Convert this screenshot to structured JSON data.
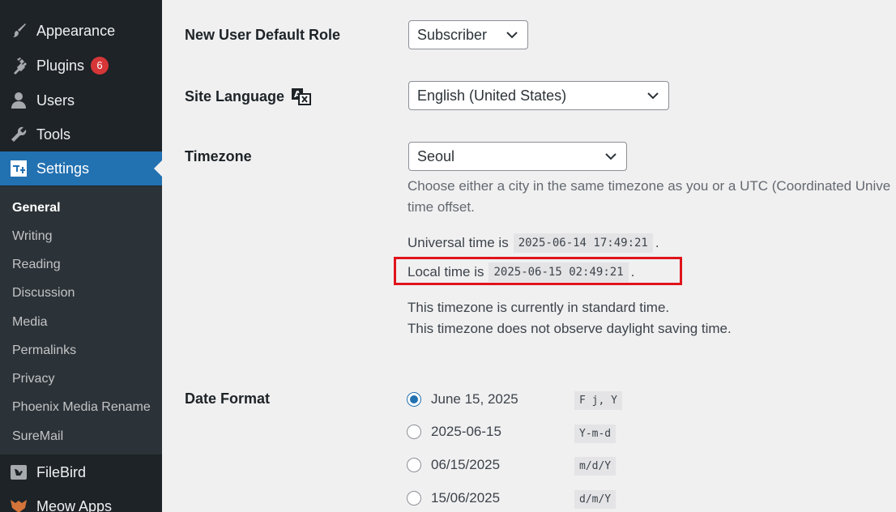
{
  "sidebar": {
    "menu": [
      {
        "label": "Appearance",
        "icon": "paintbrush-icon"
      },
      {
        "label": "Plugins",
        "icon": "plugin-icon",
        "badge": "6"
      },
      {
        "label": "Users",
        "icon": "user-icon"
      },
      {
        "label": "Tools",
        "icon": "wrench-icon"
      },
      {
        "label": "Settings",
        "icon": "settings-icon",
        "active": true
      }
    ],
    "submenu": [
      "General",
      "Writing",
      "Reading",
      "Discussion",
      "Media",
      "Permalinks",
      "Privacy",
      "Phoenix Media Rename",
      "SureMail"
    ],
    "current_submenu": "General",
    "after": [
      {
        "label": "FileBird",
        "icon": "filebird-icon"
      },
      {
        "label": "Meow Apps",
        "icon": "meow-apps-icon"
      }
    ]
  },
  "settings": {
    "default_role": {
      "label": "New User Default Role",
      "value": "Subscriber"
    },
    "site_language": {
      "label": "Site Language",
      "value": "English (United States)"
    },
    "timezone": {
      "label": "Timezone",
      "value": "Seoul",
      "description_line1": "Choose either a city in the same timezone as you or a UTC (Coordinated Unive",
      "description_line2": "time offset.",
      "universal_prefix": "Universal time is",
      "universal_value": "2025-06-14 17:49:21",
      "local_prefix": "Local time is",
      "local_value": "2025-06-15 02:49:21",
      "period": ".",
      "standard_note": "This timezone is currently in standard time.",
      "dst_note": "This timezone does not observe daylight saving time."
    },
    "date_format": {
      "label": "Date Format",
      "options": [
        {
          "label": "June 15, 2025",
          "format": "F j, Y",
          "checked": true
        },
        {
          "label": "2025-06-15",
          "format": "Y-m-d",
          "checked": false
        },
        {
          "label": "06/15/2025",
          "format": "m/d/Y",
          "checked": false
        },
        {
          "label": "15/06/2025",
          "format": "d/m/Y",
          "checked": false
        }
      ]
    }
  },
  "colors": {
    "sidebar_bg": "#1d2327",
    "active_bg": "#2271b1",
    "badge": "#d63638",
    "highlight_border": "#e0141b"
  }
}
